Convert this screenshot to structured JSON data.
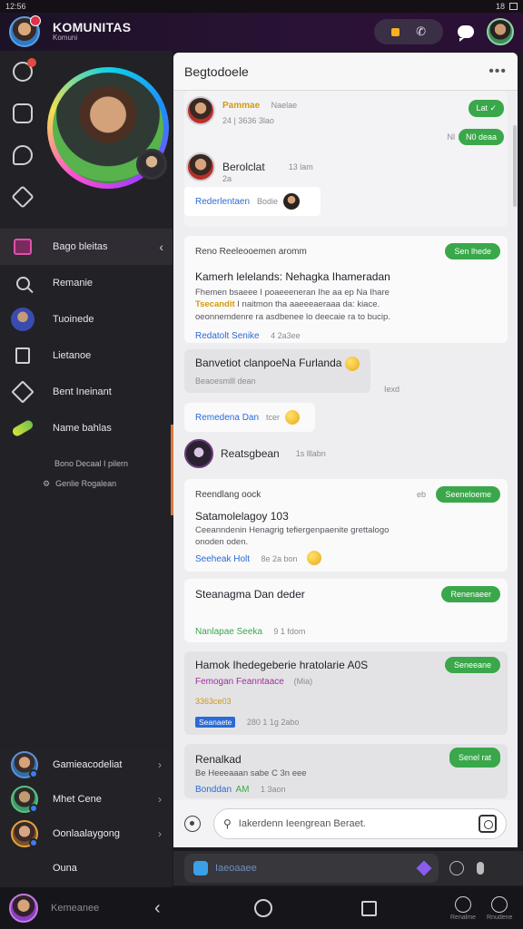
{
  "status_bar": {
    "time": "12:56",
    "indicator": "18"
  },
  "header": {
    "title": "KOMUNITAS",
    "subtitle": "Komuni",
    "pill_icon": "phone-off-icon",
    "chat_icon": "chat-bubble-icon"
  },
  "sidebar": {
    "nav": [
      {
        "label": "Bago bleitas",
        "icon": "flag-icon",
        "active": true
      },
      {
        "label": "Remanie",
        "icon": "search-icon"
      },
      {
        "label": "Tuoinede",
        "icon": "avatar-icon"
      },
      {
        "label": "Lietanoe",
        "icon": "bookmark-icon"
      },
      {
        "label": "Bent Ineinant",
        "icon": "home-icon"
      },
      {
        "label": "Name bahlas",
        "icon": "dart-icon"
      }
    ],
    "sub_items": [
      {
        "label": "Bono Decaal I pilern"
      },
      {
        "label": "Genlie Rogalean"
      }
    ],
    "friends": [
      {
        "name": "Gamieacodeliat"
      },
      {
        "name": "Mhet Cene"
      },
      {
        "name": "Oonlaalaygong"
      },
      {
        "name": "Ouna"
      }
    ]
  },
  "main": {
    "title": "Begtodoele",
    "more": "•••",
    "thread": {
      "msg1_name": "Pammae",
      "msg1_extra": "Naelae",
      "msg1_meta": "24 | 3636 3lao",
      "bubble1": "Lat",
      "bubble2": "N0 deaa",
      "bubble2_meta": "Nl",
      "msg2_name": "Berolclat",
      "msg2_meta": "13 lam",
      "msg2_sub": "2a",
      "link": "Rederlentaen",
      "link_extra": "Bodie"
    },
    "card2": {
      "label": "Reno Reeleooemen aromm",
      "chip": "Sen lhede",
      "heading": "Kamerh lelelands: Nehagka Ihameradan",
      "body_line1": "Fhemen bsaeee I poaeeeneran Ihe aa ep Na Ihare",
      "body_hl": "Tsecandit",
      "body_line2": "I naitmon tha aaeeeaeraaa da: kiace.",
      "body_line3": "oeonnemdenre ra asdbenee lo deecaie ra to bucip.",
      "link": "Redatolt Senike",
      "meta": "4 2a3ee"
    },
    "card3": {
      "text": "Banvetiot clanpoeNa Furlanda",
      "sub": "Beaoesmlll dean",
      "meta": "Iexd"
    },
    "pill_link": {
      "text": "Remedena Dan",
      "extra": "tcer"
    },
    "card4": {
      "name": "Reatsgbean",
      "meta": "1s lllabn"
    },
    "card5": {
      "label": "Reendlang oock",
      "chip": "Seeneloeme",
      "meta_icon": "eb",
      "heading": "Satamolelagoy 103",
      "body": "Ceeanndenin Henagrig tefiergenpaenite grettalogo",
      "body2": "onoden oden.",
      "link": "Seeheak Holt",
      "meta": "8e 2a bon"
    },
    "card6": {
      "heading": "Steanagma Dan deder",
      "chip": "Renenaeer",
      "link": "Nanlapae Seeka",
      "meta": "9 1 fdom"
    },
    "card7": {
      "heading": "Hamok Ihedegeberie hratolarie A0S",
      "chip": "Seneeane",
      "purple": "Femogan Feanntaace",
      "purple_extra": "(Mia)",
      "yellow": "3363ce03",
      "tag": "Seanaete",
      "meta": "280  1 1g 2abo"
    },
    "card8": {
      "heading": "Renalkad",
      "chip": "Senel rat",
      "body": "Be Heeeaaan sabe C 3n eee",
      "link": "Bonddan",
      "link2": "AM",
      "meta": "1 3aon"
    },
    "composer": {
      "placeholder": "Iakerdenn Ieengrean Beraet."
    }
  },
  "inputbar": {
    "placeholder": "Iaeoaaee"
  },
  "bottomnav": {
    "label": "Kemeanee",
    "tab1": "Renalme",
    "tab2": "Rnudene"
  }
}
